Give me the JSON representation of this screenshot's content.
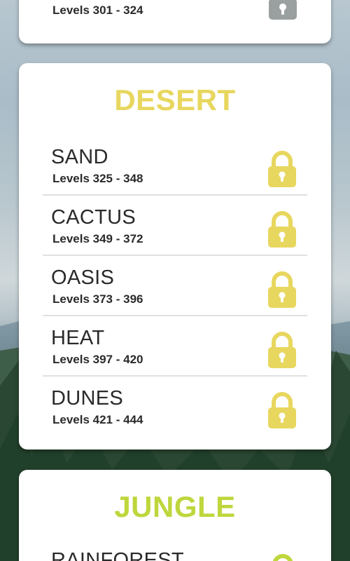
{
  "colors": {
    "desert_accent": "#e8d75f",
    "jungle_accent": "#bfd63c",
    "locked_grey": "#9aa0a0",
    "text": "#2a2a2a"
  },
  "top_card": {
    "levels": "Levels 301 - 324",
    "icon": "lock-icon"
  },
  "desert": {
    "title": "DESERT",
    "worlds": [
      {
        "name": "SAND",
        "levels": "Levels 325 - 348",
        "icon": "lock-icon"
      },
      {
        "name": "CACTUS",
        "levels": "Levels 349 - 372",
        "icon": "lock-icon"
      },
      {
        "name": "OASIS",
        "levels": "Levels 373 - 396",
        "icon": "lock-icon"
      },
      {
        "name": "HEAT",
        "levels": "Levels 397 - 420",
        "icon": "lock-icon"
      },
      {
        "name": "DUNES",
        "levels": "Levels 421 - 444",
        "icon": "lock-icon"
      }
    ]
  },
  "jungle": {
    "title": "JUNGLE",
    "worlds": [
      {
        "name": "RAINFOREST",
        "icon": "lock-icon"
      }
    ]
  }
}
